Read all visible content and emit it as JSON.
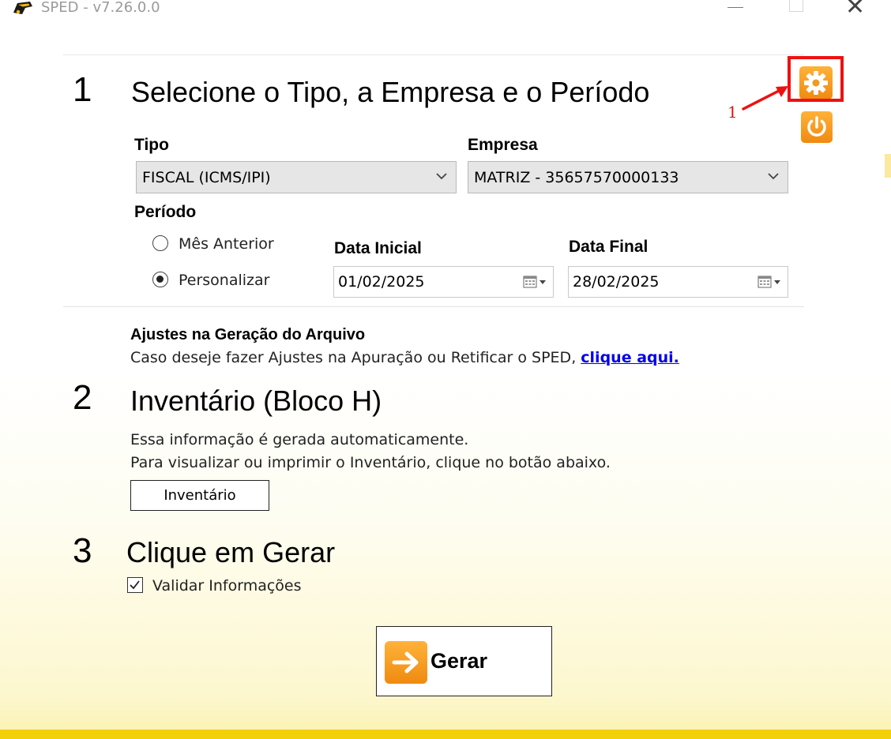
{
  "window": {
    "title": "SPED - v7.26.0.0"
  },
  "annotation": {
    "marker": "1"
  },
  "step1": {
    "number": "1",
    "title": "Selecione o Tipo, a Empresa e o Período",
    "tipo_label": "Tipo",
    "tipo_value": "FISCAL (ICMS/IPI)",
    "empresa_label": "Empresa",
    "empresa_value": "MATRIZ - 35657570000133",
    "periodo_label": "Período",
    "option_mes_anterior": "Mês Anterior",
    "option_personalizar": "Personalizar",
    "selected_option": "Personalizar",
    "data_inicial_label": "Data Inicial",
    "data_inicial_value": "01/02/2025",
    "data_final_label": "Data Final",
    "data_final_value": "28/02/2025"
  },
  "ajustes": {
    "title": "Ajustes na Geração do Arquivo",
    "text": "Caso deseje fazer Ajustes na Apuração ou Retificar o SPED,",
    "link": "clique aqui."
  },
  "step2": {
    "number": "2",
    "title": "Inventário (Bloco H)",
    "line1": "Essa informação é gerada automaticamente.",
    "line2": "Para visualizar ou imprimir o Inventário, clique no botão abaixo.",
    "button": "Inventário"
  },
  "step3": {
    "number": "3",
    "title": "Clique em Gerar",
    "checkbox_label": "Validar Informações",
    "checkbox_checked": true,
    "button": "Gerar"
  },
  "colors": {
    "accent_orange": "#f5a020",
    "highlight_red": "#e11111",
    "link_blue": "#0000ee",
    "bottom_bar": "#f2d10a"
  },
  "icons": [
    "app-logo-icon",
    "minimize-icon",
    "maximize-icon",
    "close-icon",
    "gear-icon",
    "power-icon",
    "chevron-down-icon",
    "calendar-icon",
    "arrow-right-icon",
    "checkmark-icon"
  ]
}
